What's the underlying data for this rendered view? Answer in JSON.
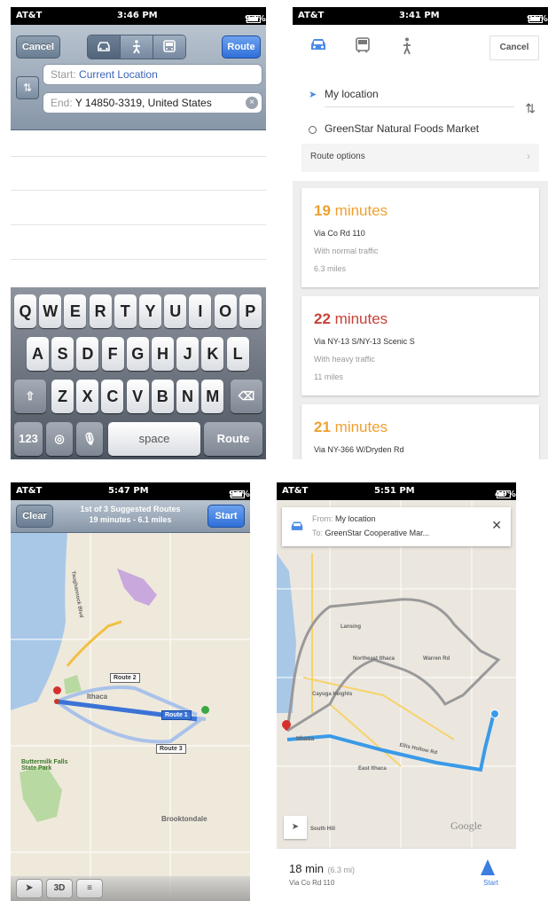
{
  "panel1": {
    "status": {
      "carrier": "AT&T",
      "time": "3:46 PM",
      "battery": "97%"
    },
    "cancel_label": "Cancel",
    "route_label": "Route",
    "transport_modes": [
      "car-icon",
      "walk-icon",
      "bus-icon"
    ],
    "start_label": "Start:",
    "start_value": "Current Location",
    "end_label": "End:",
    "end_value": "Y 14850-3319, United States",
    "keyboard": {
      "row1": [
        "Q",
        "W",
        "E",
        "R",
        "T",
        "Y",
        "U",
        "I",
        "O",
        "P"
      ],
      "row2": [
        "A",
        "S",
        "D",
        "F",
        "G",
        "H",
        "J",
        "K",
        "L"
      ],
      "row3": [
        "Z",
        "X",
        "C",
        "V",
        "B",
        "N",
        "M"
      ],
      "numbers_label": "123",
      "space_label": "space",
      "return_label": "Route"
    }
  },
  "panel2": {
    "status": {
      "carrier": "AT&T",
      "time": "3:41 PM",
      "battery": "96%"
    },
    "cancel_label": "Cancel",
    "from_value": "My location",
    "to_value": "GreenStar Natural Foods Market",
    "route_options_label": "Route options",
    "routes": [
      {
        "minutes": "19",
        "unit": "minutes",
        "via": "Via Co Rd 110",
        "traffic": "With normal traffic",
        "distance": "6.3 miles",
        "color": "#f0a030"
      },
      {
        "minutes": "22",
        "unit": "minutes",
        "via": "Via NY-13 S/NY-13 Scenic S",
        "traffic": "With heavy traffic",
        "distance": "11 miles",
        "color": "#c8413a"
      },
      {
        "minutes": "21",
        "unit": "minutes",
        "via": "Via NY-366 W/Dryden Rd",
        "traffic": "",
        "distance": "",
        "color": "#f0a030"
      }
    ]
  },
  "panel3": {
    "status": {
      "carrier": "AT&T",
      "time": "5:47 PM",
      "battery": "91%"
    },
    "clear_label": "Clear",
    "summary_line1": "1st of 3 Suggested Routes",
    "summary_line2": "19 minutes - 6.1 miles",
    "start_label": "Start",
    "route_labels": [
      "Route 1",
      "Route 2",
      "Route 3"
    ],
    "map_labels": {
      "city": "Ithaca",
      "park": "Buttermilk Falls State Park",
      "town": "Brooktondale",
      "road": "Taughannock Blvd"
    },
    "bottom_3d": "3D"
  },
  "panel4": {
    "status": {
      "carrier": "AT&T",
      "time": "5:51 PM",
      "battery": "49%"
    },
    "from_label": "From:",
    "from_value": "My location",
    "to_label": "To:",
    "to_value": "GreenStar Cooperative Mar...",
    "map_labels": {
      "city": "Ithaca",
      "ne": "Northeast Ithaca",
      "heights": "Cayuga Heights",
      "lansing": "Lansing",
      "east": "East Ithaca",
      "south": "South Hill",
      "road": "Ellis Hollow Rd",
      "warren": "Warren Rd",
      "watermark": "Google"
    },
    "summary_time": "18 min",
    "summary_distance": "(6.3 mi)",
    "summary_via": "Via Co Rd 110",
    "start_label": "Start"
  }
}
